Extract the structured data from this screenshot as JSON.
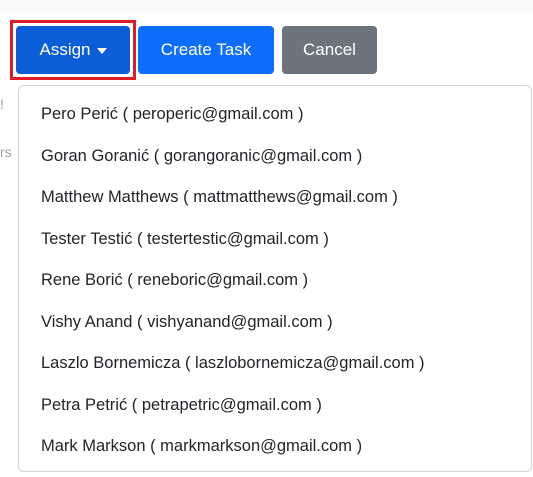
{
  "toolbar": {
    "assign_label": "Assign",
    "create_task_label": "Create Task",
    "cancel_label": "Cancel"
  },
  "background_fragments": [
    "!",
    "rs"
  ],
  "dropdown": {
    "items": [
      "Pero Perić ( peroperic@gmail.com )",
      "Goran Goranić ( gorangoranic@gmail.com )",
      "Matthew Matthews ( mattmatthews@gmail.com )",
      "Tester Testić ( testertestic@gmail.com )",
      "Rene Borić ( reneboric@gmail.com )",
      "Vishy Anand ( vishyanand@gmail.com )",
      "Laszlo Bornemicza ( laszlobornemicza@gmail.com )",
      "Petra Petrić ( petrapetric@gmail.com )",
      "Mark Markson ( markmarkson@gmail.com )"
    ]
  },
  "colors": {
    "assign_bg": "#0b5ed7",
    "primary": "#0d6efd",
    "secondary": "#6c757d",
    "highlight": "#e01d26"
  }
}
